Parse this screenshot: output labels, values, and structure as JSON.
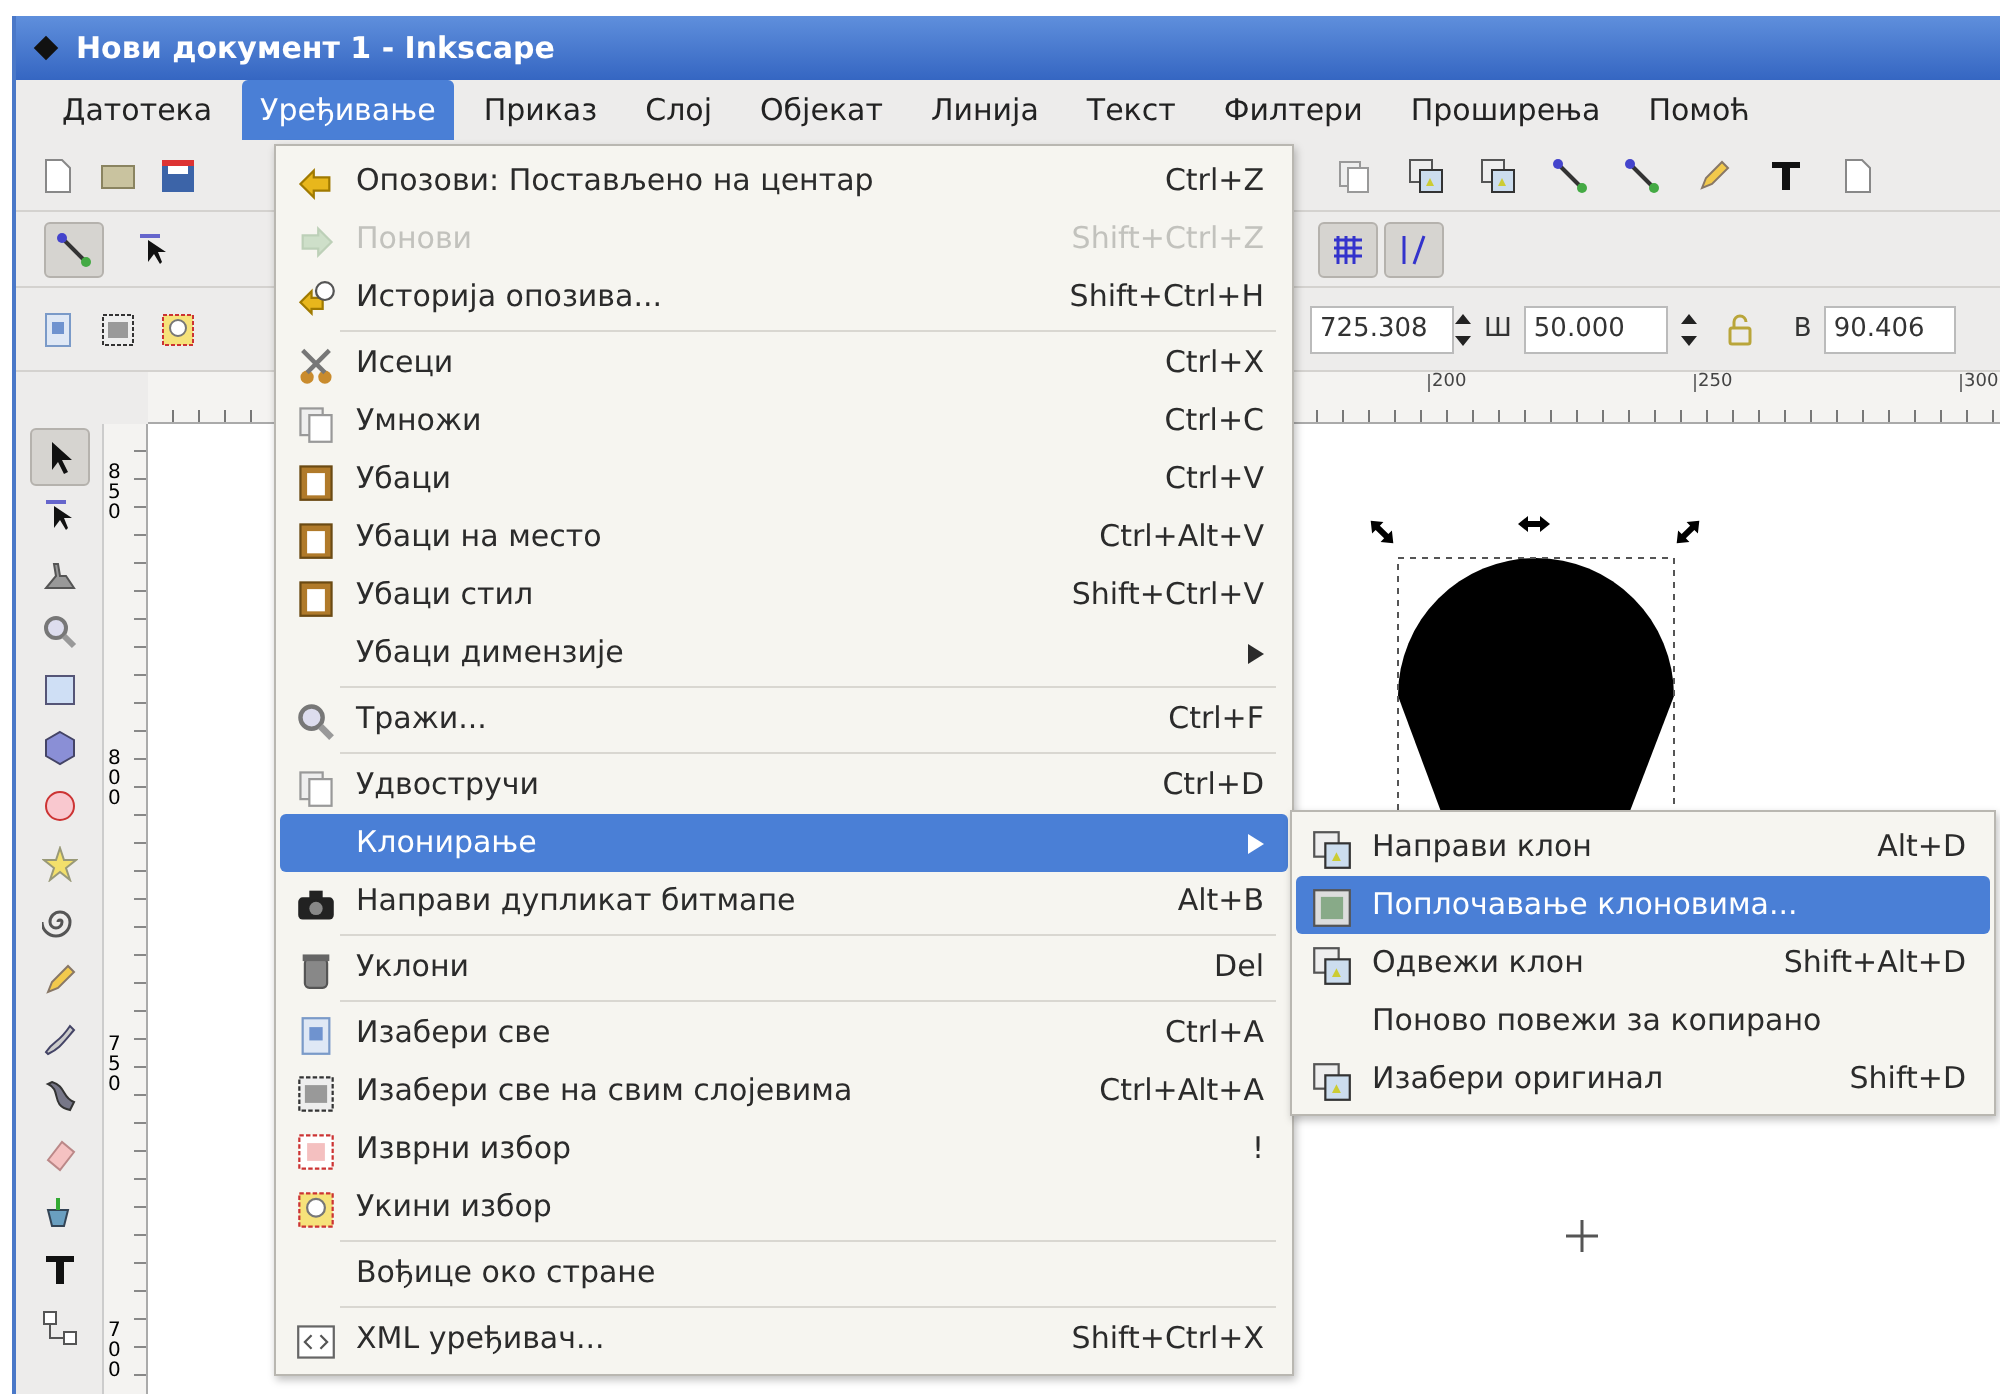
{
  "window": {
    "title": "Нови документ 1 - Inkscape"
  },
  "menubar": [
    {
      "label": "Датотека",
      "selected": false
    },
    {
      "label": "Уређивање",
      "selected": true
    },
    {
      "label": "Приказ",
      "selected": false
    },
    {
      "label": "Слој",
      "selected": false
    },
    {
      "label": "Објекат",
      "selected": false
    },
    {
      "label": "Линија",
      "selected": false
    },
    {
      "label": "Текст",
      "selected": false
    },
    {
      "label": "Филтери",
      "selected": false
    },
    {
      "label": "Проширења",
      "selected": false
    },
    {
      "label": "Помоћ",
      "selected": false
    }
  ],
  "tool_controls": {
    "x_value": "725.308",
    "width_label": "Ш",
    "width_value": "50.000",
    "height_label": "В",
    "height_value": "90.406"
  },
  "ruler": {
    "labels": [
      "200",
      "250",
      "300"
    ]
  },
  "vertical_ruler": {
    "labels": [
      "850",
      "800",
      "750",
      "700"
    ]
  },
  "tools": [
    {
      "selected": true
    },
    {
      "selected": false
    },
    {
      "selected": false
    },
    {
      "selected": false
    },
    {
      "selected": false
    },
    {
      "selected": false
    },
    {
      "selected": false
    },
    {
      "selected": false
    },
    {
      "selected": false
    },
    {
      "selected": false
    },
    {
      "selected": false
    },
    {
      "selected": false
    },
    {
      "selected": false
    },
    {
      "selected": false
    },
    {
      "selected": false
    },
    {
      "selected": false
    }
  ],
  "edit_menu": [
    {
      "kind": "item",
      "label": "Опозови: Постављено на центар",
      "shortcut": "Ctrl+Z",
      "disabled": false,
      "selected": false,
      "has_icon": true,
      "has_submenu": false
    },
    {
      "kind": "item",
      "label": "Понови",
      "shortcut": "Shift+Ctrl+Z",
      "disabled": true,
      "selected": false,
      "has_icon": true,
      "has_submenu": false
    },
    {
      "kind": "item",
      "label": "Историја опозива...",
      "shortcut": "Shift+Ctrl+H",
      "disabled": false,
      "selected": false,
      "has_icon": true,
      "has_submenu": false
    },
    {
      "kind": "separator"
    },
    {
      "kind": "item",
      "label": "Исеци",
      "shortcut": "Ctrl+X",
      "disabled": false,
      "selected": false,
      "has_icon": true,
      "has_submenu": false
    },
    {
      "kind": "item",
      "label": "Умножи",
      "shortcut": "Ctrl+C",
      "disabled": false,
      "selected": false,
      "has_icon": true,
      "has_submenu": false
    },
    {
      "kind": "item",
      "label": "Убаци",
      "shortcut": "Ctrl+V",
      "disabled": false,
      "selected": false,
      "has_icon": true,
      "has_submenu": false
    },
    {
      "kind": "item",
      "label": "Убаци на место",
      "shortcut": "Ctrl+Alt+V",
      "disabled": false,
      "selected": false,
      "has_icon": true,
      "has_submenu": false
    },
    {
      "kind": "item",
      "label": "Убаци стил",
      "shortcut": "Shift+Ctrl+V",
      "disabled": false,
      "selected": false,
      "has_icon": true,
      "has_submenu": false
    },
    {
      "kind": "item",
      "label": "Убаци димензије",
      "disabled": false,
      "selected": false,
      "has_icon": false,
      "has_submenu": true
    },
    {
      "kind": "separator"
    },
    {
      "kind": "item",
      "label": "Тражи...",
      "shortcut": "Ctrl+F",
      "disabled": false,
      "selected": false,
      "has_icon": true,
      "has_submenu": false
    },
    {
      "kind": "separator"
    },
    {
      "kind": "item",
      "label": "Удвостручи",
      "shortcut": "Ctrl+D",
      "disabled": false,
      "selected": false,
      "has_icon": true,
      "has_submenu": false
    },
    {
      "kind": "item",
      "label": "Клонирање",
      "disabled": false,
      "selected": true,
      "has_icon": false,
      "has_submenu": true
    },
    {
      "kind": "item",
      "label": "Направи дупликат битмапе",
      "shortcut": "Alt+B",
      "disabled": false,
      "selected": false,
      "has_icon": true,
      "has_submenu": false
    },
    {
      "kind": "separator"
    },
    {
      "kind": "item",
      "label": "Уклони",
      "shortcut": "Del",
      "disabled": false,
      "selected": false,
      "has_icon": true,
      "has_submenu": false
    },
    {
      "kind": "separator"
    },
    {
      "kind": "item",
      "label": "Изабери све",
      "shortcut": "Ctrl+A",
      "disabled": false,
      "selected": false,
      "has_icon": true,
      "has_submenu": false
    },
    {
      "kind": "item",
      "label": "Изабери све на свим слојевима",
      "shortcut": "Ctrl+Alt+A",
      "disabled": false,
      "selected": false,
      "has_icon": true,
      "has_submenu": false
    },
    {
      "kind": "item",
      "label": "Изврни избор",
      "shortcut": "!",
      "disabled": false,
      "selected": false,
      "has_icon": true,
      "has_submenu": false
    },
    {
      "kind": "item",
      "label": "Укини избор",
      "disabled": false,
      "selected": false,
      "has_icon": true,
      "has_submenu": false
    },
    {
      "kind": "separator"
    },
    {
      "kind": "item",
      "label": "Вођице око стране",
      "disabled": false,
      "selected": false,
      "has_icon": false,
      "has_submenu": false
    },
    {
      "kind": "separator"
    },
    {
      "kind": "item",
      "label": "XML уређивач...",
      "shortcut": "Shift+Ctrl+X",
      "disabled": false,
      "selected": false,
      "has_icon": true,
      "has_submenu": false
    }
  ],
  "clone_submenu": [
    {
      "label": "Направи клон",
      "shortcut": "Alt+D",
      "selected": false,
      "has_icon": true
    },
    {
      "label": "Поплочавање клоновима...",
      "selected": true,
      "has_icon": true
    },
    {
      "label": "Одвежи клон",
      "shortcut": "Shift+Alt+D",
      "selected": false,
      "has_icon": true
    },
    {
      "label": "Поново повежи за копирано",
      "selected": false,
      "has_icon": false
    },
    {
      "label": "Изабери оригинал",
      "shortcut": "Shift+D",
      "selected": false,
      "has_icon": true
    }
  ]
}
